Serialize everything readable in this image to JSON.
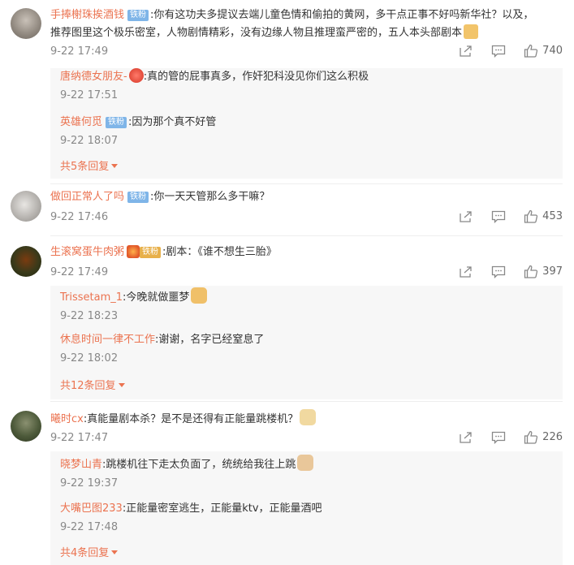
{
  "comments": [
    {
      "user": "手捧榭珠挨酒钱",
      "badge": "铁粉",
      "text_line1": "你有这功夫多提议去端儿童色情和偷拍的黄网，多干点正事不好吗新华社？以及，",
      "text_line2": "推荐图里这个极乐密室，人物剧情精彩，没有边缘人物且推理蛮严密的，五人本头部剧本",
      "time": "9-22 17:49",
      "likes": "740",
      "replies": [
        {
          "user": "唐纳德女朋友-",
          "text": "真的管的屁事真多，作奸犯科没见你们这么积极",
          "time": "9-22 17:51"
        },
        {
          "user": "英雄何觅",
          "badge": "铁粉",
          "text": "因为那个真不好管",
          "time": "9-22 18:07"
        }
      ],
      "more": "共5条回复"
    },
    {
      "user": "做回正常人了吗",
      "badge": "铁粉",
      "text_line1": "你一天天管那么多干嘛？",
      "time": "9-22 17:46",
      "likes": "453"
    },
    {
      "user": "生滚窝蛋牛肉粥",
      "badge": "铁粉",
      "text_line1": "剧本：《谁不想生三胎》",
      "time": "9-22 17:49",
      "likes": "397",
      "replies": [
        {
          "user": "Trissetam_1",
          "text": "今晚就做噩梦",
          "time": "9-22 18:23"
        },
        {
          "user": "休息时间一律不工作",
          "text": "谢谢，名字已经窒息了",
          "time": "9-22 18:02"
        }
      ],
      "more": "共12条回复"
    },
    {
      "user": "曦时cx",
      "text_line1": "真能量剧本杀？是不是还得有正能量跳楼机？",
      "time": "9-22 17:47",
      "likes": "226",
      "replies": [
        {
          "user": "晓梦山青",
          "text": "跳楼机往下走太负面了，统统给我往上跳",
          "time": "9-22 19:37"
        },
        {
          "user": "大嘴巴图233",
          "text": "正能量密室逃生，正能量ktv，正能量酒吧",
          "time": "9-22 17:48"
        }
      ],
      "more": "共4条回复"
    }
  ],
  "colors": {
    "accent": "#eb7350",
    "badge": "#7fb5e8",
    "reply_bg": "#f7f7f7"
  },
  "icons": {
    "share": "share-icon",
    "comment": "comment-icon",
    "like": "thumbs-up-icon"
  }
}
